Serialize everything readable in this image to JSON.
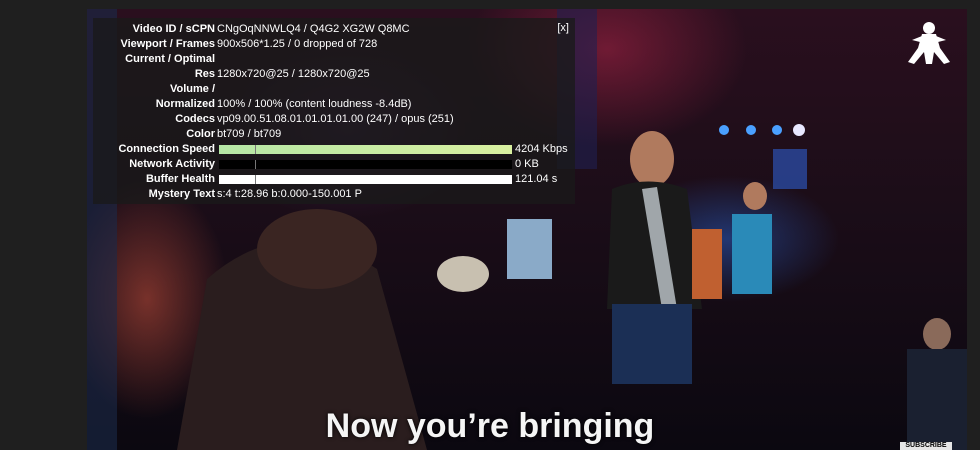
{
  "stats": {
    "close_label": "[x]",
    "rows": [
      {
        "label": "Video ID / sCPN",
        "value": "CNgOqNNWLQ4 / Q4G2 XG2W Q8MC"
      },
      {
        "label": "Viewport / Frames",
        "value": "900x506*1.25 / 0 dropped of 728"
      },
      {
        "label": "Current / Optimal",
        "value": ""
      },
      {
        "label": "Res",
        "value": "1280x720@25 / 1280x720@25"
      },
      {
        "label": "Volume /",
        "value": ""
      },
      {
        "label": "Normalized",
        "value": "100% / 100% (content loudness -8.4dB)"
      },
      {
        "label": "Codecs",
        "value": "vp09.00.51.08.01.01.01.01.00 (247) / opus (251)"
      },
      {
        "label": "Color",
        "value": "bt709 / bt709"
      },
      {
        "label": "Connection Speed",
        "value": "4204 Kbps"
      },
      {
        "label": "Network Activity",
        "value": "0 KB"
      },
      {
        "label": "Buffer Health",
        "value": "121.04 s"
      },
      {
        "label": "Mystery Text",
        "value": "s:4 t:28.96 b:0.000-150.001 P"
      }
    ]
  },
  "caption": "Now you’re bringing",
  "subscribe_label": "SUBSCRIBE",
  "colors": {
    "panel_bg": "#191919",
    "speed_bar": "#c8eca2",
    "buffer_bar": "#ffffff",
    "network_bar": "#000000"
  }
}
